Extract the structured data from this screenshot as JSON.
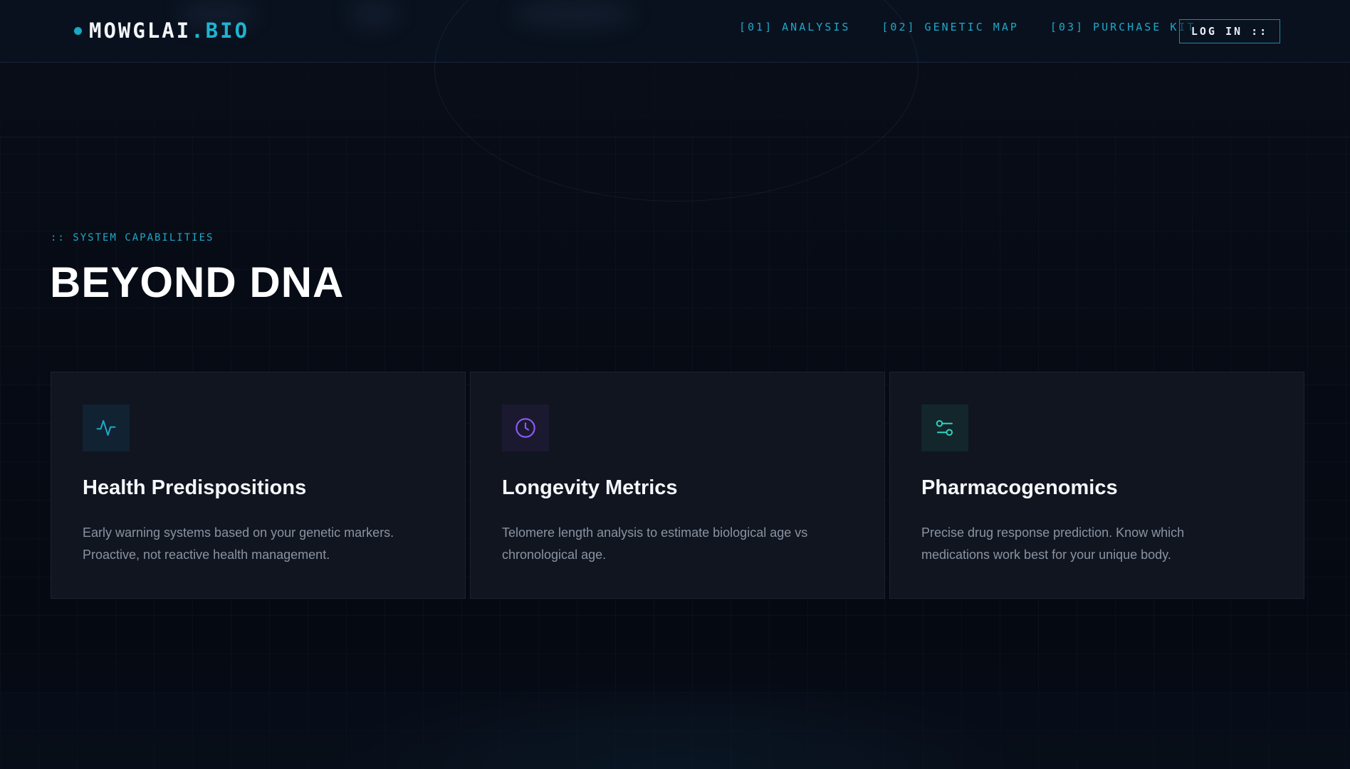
{
  "brand": {
    "name": "MOWGLAI",
    "suffix": ".BIO",
    "accent_color": "#1fb3d1"
  },
  "nav": {
    "links": [
      {
        "label": "[01] ANALYSIS"
      },
      {
        "label": "[02] GENETIC MAP"
      },
      {
        "label": "[03] PURCHASE KIT"
      }
    ],
    "login_label": "LOG IN ::"
  },
  "section": {
    "eyebrow": ":: SYSTEM CAPABILITIES",
    "title": "BEYOND DNA"
  },
  "cards": [
    {
      "icon": "activity-pulse-icon",
      "icon_color": "#1fa8c8",
      "title": "Health Predispositions",
      "description": "Early warning systems based on your genetic markers. Proactive, not reactive health management."
    },
    {
      "icon": "clock-icon",
      "icon_color": "#8b5cf6",
      "title": "Longevity Metrics",
      "description": "Telomere length analysis to estimate biological age vs chronological age."
    },
    {
      "icon": "sliders-icon",
      "icon_color": "#2dd4bf",
      "title": "Pharmacogenomics",
      "description": "Precise drug response prediction. Know which medications work best for your unique body."
    }
  ]
}
